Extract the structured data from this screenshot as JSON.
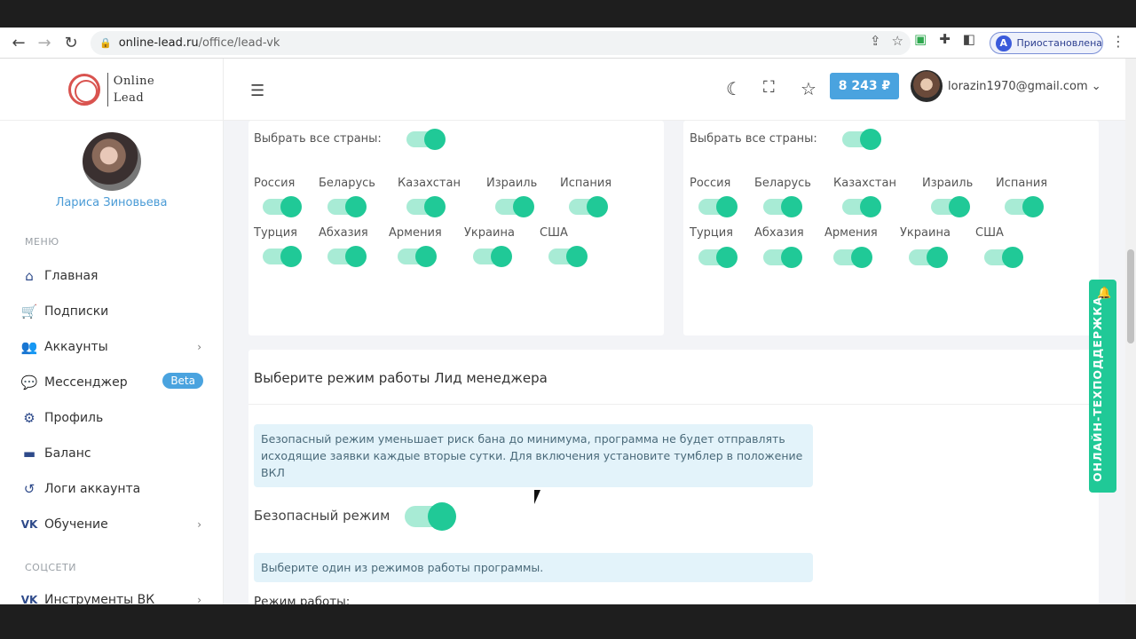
{
  "browser": {
    "url_host": "online-lead.ru",
    "url_path": "/office/lead-vk",
    "profile_status": "Приостановлена",
    "profile_initial": "A"
  },
  "logo": {
    "line1": "Online",
    "line2": "Lead"
  },
  "sidebar": {
    "user_name": "Лариса Зиновьева",
    "menu_title": "МЕНЮ",
    "items": [
      {
        "label": "Главная",
        "icon": "home-icon"
      },
      {
        "label": "Подписки",
        "icon": "cart-icon"
      },
      {
        "label": "Аккаунты",
        "icon": "users-icon"
      },
      {
        "label": "Мессенджер",
        "icon": "chat-icon",
        "badge": "Beta"
      },
      {
        "label": "Профиль",
        "icon": "gear-icon"
      },
      {
        "label": "Баланс",
        "icon": "wallet-icon"
      },
      {
        "label": "Логи аккаунта",
        "icon": "history-icon"
      },
      {
        "label": "Обучение",
        "icon": "vk-icon"
      }
    ],
    "social_title": "СОЦСЕТИ",
    "social_items": [
      {
        "label": "Инструменты ВК",
        "icon": "vk-icon"
      }
    ]
  },
  "header": {
    "balance": "8 243 ₽",
    "email": "lorazin1970@gmail.com"
  },
  "countries_left": {
    "select_all": "Выбрать все страны:",
    "row1": [
      "Россия",
      "Беларусь",
      "Казахстан",
      "Израиль",
      "Испания"
    ],
    "row2": [
      "Турция",
      "Абхазия",
      "Армения",
      "Украина",
      "США"
    ]
  },
  "countries_right": {
    "select_all": "Выбрать все страны:",
    "row1": [
      "Россия",
      "Беларусь",
      "Казахстан",
      "Израиль",
      "Испания"
    ],
    "row2": [
      "Турция",
      "Абхазия",
      "Армения",
      "Украина",
      "США"
    ]
  },
  "mode": {
    "title": "Выберите режим работы Лид менеджера",
    "safe_info": "Безопасный режим уменьшает риск бана до минимума, программа не будет отправлять исходящие заявки каждые вторые сутки. Для включения установите тумблер в положение ВКЛ",
    "safe_label": "Безопасный режим",
    "choose_info": "Выберите один из режимов работы программы.",
    "work_mode_label": "Режим работы:"
  },
  "support": {
    "label": "ОНЛАЙН-ТЕХПОДДЕРЖКА"
  }
}
